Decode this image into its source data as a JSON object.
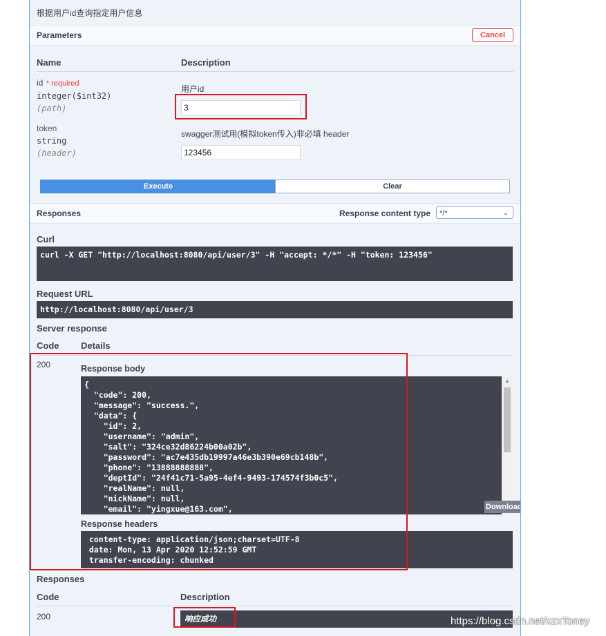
{
  "summary": "根据用户id查询指定用户信息",
  "parameters": {
    "title": "Parameters",
    "cancel_label": "Cancel",
    "col_name": "Name",
    "col_description": "Description",
    "params": [
      {
        "name": "id",
        "required_label": "* required",
        "type": "integer($int32)",
        "in": "(path)",
        "description": "用户id",
        "value": "3"
      },
      {
        "name": "token",
        "type": "string",
        "in": "(header)",
        "description": "swagger测试用(模拟token传入)非必填 header",
        "value": "123456"
      }
    ],
    "execute_label": "Execute",
    "clear_label": "Clear"
  },
  "responses_bar": {
    "title": "Responses",
    "content_type_label": "Response content type",
    "content_type_value": "*/*"
  },
  "curl": {
    "label": "Curl",
    "command": "curl -X GET \"http://localhost:8080/api/user/3\" -H \"accept: */*\" -H \"token: 123456\""
  },
  "request_url": {
    "label": "Request URL",
    "value": "http://localhost:8080/api/user/3"
  },
  "server_response": {
    "label": "Server response",
    "col_code": "Code",
    "col_details": "Details",
    "code": "200",
    "body_label": "Response body",
    "body": "{\n  \"code\": 200,\n  \"message\": \"success.\",\n  \"data\": {\n    \"id\": 2,\n    \"username\": \"admin\",\n    \"salt\": \"324ce32d86224b00a02b\",\n    \"password\": \"ac7e435db19997a46e3b390e69cb148b\",\n    \"phone\": \"13888888888\",\n    \"deptId\": \"24f41c71-5a95-4ef4-9493-174574f3b0c5\",\n    \"realName\": null,\n    \"nickName\": null,\n    \"email\": \"yingxue@163.com\",",
    "download_label": "Download",
    "headers_label": "Response headers",
    "headers": " content-type: application/json;charset=UTF-8\n date: Mon, 13 Apr 2020 12:52:59 GMT\n transfer-encoding: chunked"
  },
  "responses_table": {
    "title": "Responses",
    "col_code": "Code",
    "col_description": "Description",
    "code": "200",
    "description": "响应成功"
  },
  "watermark": "https://blog.csdn.net/xzxToney",
  "colors": {
    "accent": "#61affe",
    "execute": "#4990e2",
    "cancel": "#f93e3e",
    "highlight": "#d7191c"
  }
}
